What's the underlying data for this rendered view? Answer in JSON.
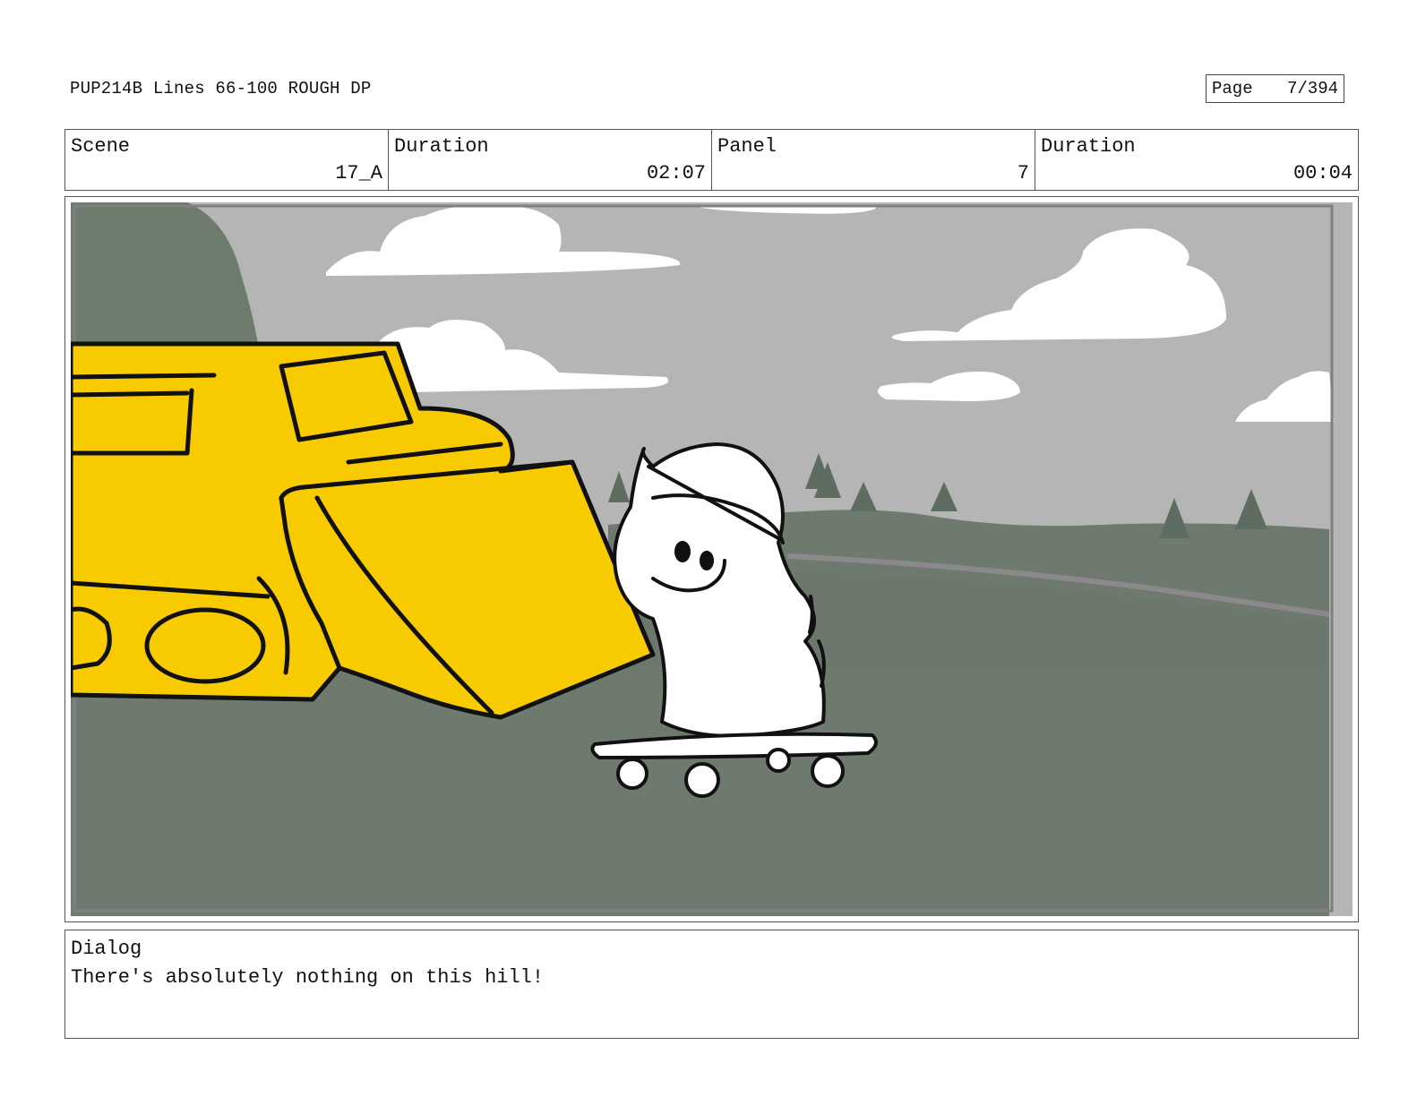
{
  "header": {
    "title": "PUP214B Lines 66-100 ROUGH DP",
    "page_label": "Page",
    "page_value": "7/394"
  },
  "info": {
    "scene_label": "Scene",
    "scene_value": "17_A",
    "scene_duration_label": "Duration",
    "scene_duration_value": "02:07",
    "panel_label": "Panel",
    "panel_value": "7",
    "panel_duration_label": "Duration",
    "panel_duration_value": "00:04"
  },
  "dialog": {
    "label": "Dialog",
    "text": "There's absolutely nothing on this hill!"
  },
  "colors": {
    "sky": "#b5b5b5",
    "hill": "#6f7a6f",
    "bulldozer": "#f8cb00",
    "outline": "#111111"
  }
}
